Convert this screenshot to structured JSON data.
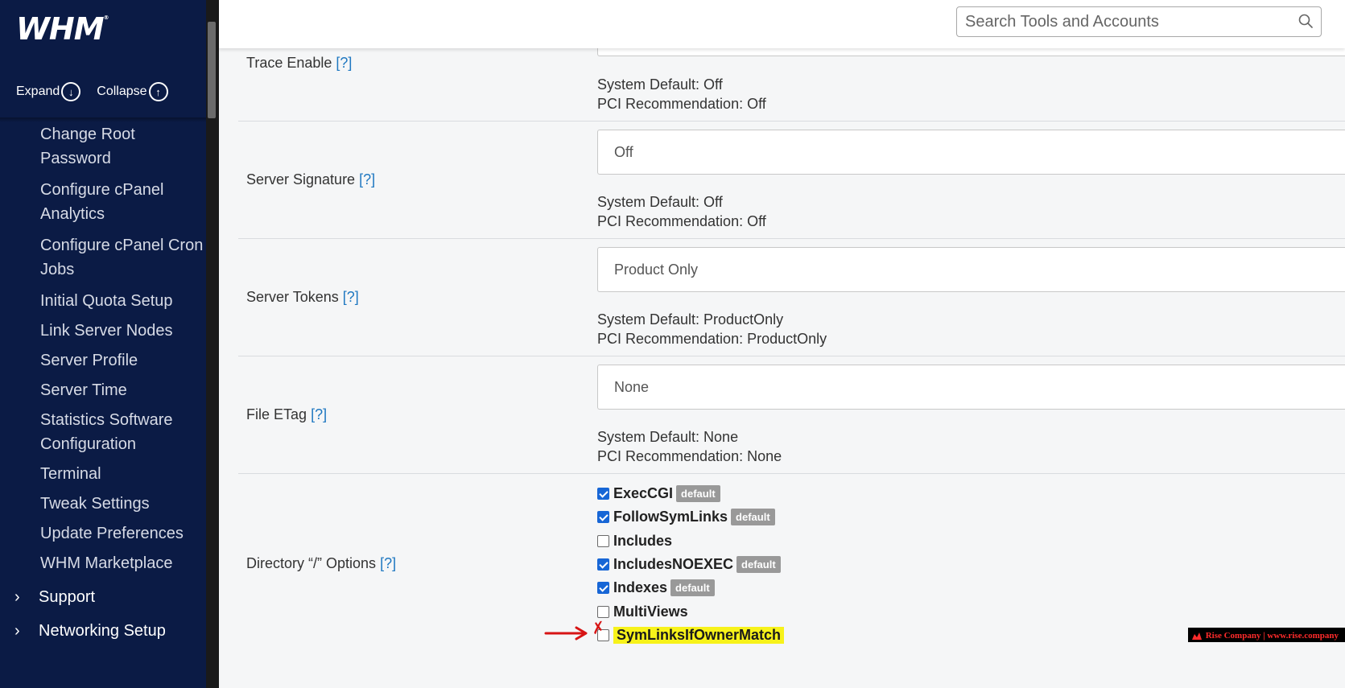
{
  "sidebar": {
    "logo": "WHM",
    "logo_mark": "®",
    "expand_label": "Expand",
    "collapse_label": "Collapse",
    "items": [
      "Change Root Password",
      "Configure cPanel Analytics",
      "Configure cPanel Cron Jobs",
      "Initial Quota Setup",
      "Link Server Nodes",
      "Server Profile",
      "Server Time",
      "Statistics Software Configuration",
      "Terminal",
      "Tweak Settings",
      "Update Preferences",
      "WHM Marketplace"
    ],
    "groups": [
      "Support",
      "Networking Setup"
    ]
  },
  "header": {
    "search_placeholder": "Search Tools and Accounts"
  },
  "settings": {
    "help_label": "[?]",
    "rows": [
      {
        "label": "Trace Enable",
        "system_default": "System Default: Off",
        "pci": "PCI Recommendation: Off"
      },
      {
        "label": "Server Signature",
        "value": "Off",
        "system_default": "System Default: Off",
        "pci": "PCI Recommendation: Off"
      },
      {
        "label": "Server Tokens",
        "value": "Product Only",
        "system_default": "System Default: ProductOnly",
        "pci": "PCI Recommendation: ProductOnly"
      },
      {
        "label": "File ETag",
        "value": "None",
        "system_default": "System Default: None",
        "pci": "PCI Recommendation: None"
      }
    ],
    "directory": {
      "label": "Directory “/” Options",
      "default_badge": "default",
      "options": [
        {
          "name": "ExecCGI",
          "checked": true,
          "default": true
        },
        {
          "name": "FollowSymLinks",
          "checked": true,
          "default": true
        },
        {
          "name": "Includes",
          "checked": false,
          "default": false
        },
        {
          "name": "IncludesNOEXEC",
          "checked": true,
          "default": true
        },
        {
          "name": "Indexes",
          "checked": true,
          "default": true
        },
        {
          "name": "MultiViews",
          "checked": false,
          "default": false
        },
        {
          "name": "SymLinksIfOwnerMatch",
          "checked": false,
          "default": false,
          "highlighted": true
        }
      ]
    }
  },
  "annotation": {
    "arrow_color": "#d71414",
    "highlight_color": "#f7f21a"
  },
  "watermark": {
    "text": "Rise Company | www.rise.company"
  }
}
